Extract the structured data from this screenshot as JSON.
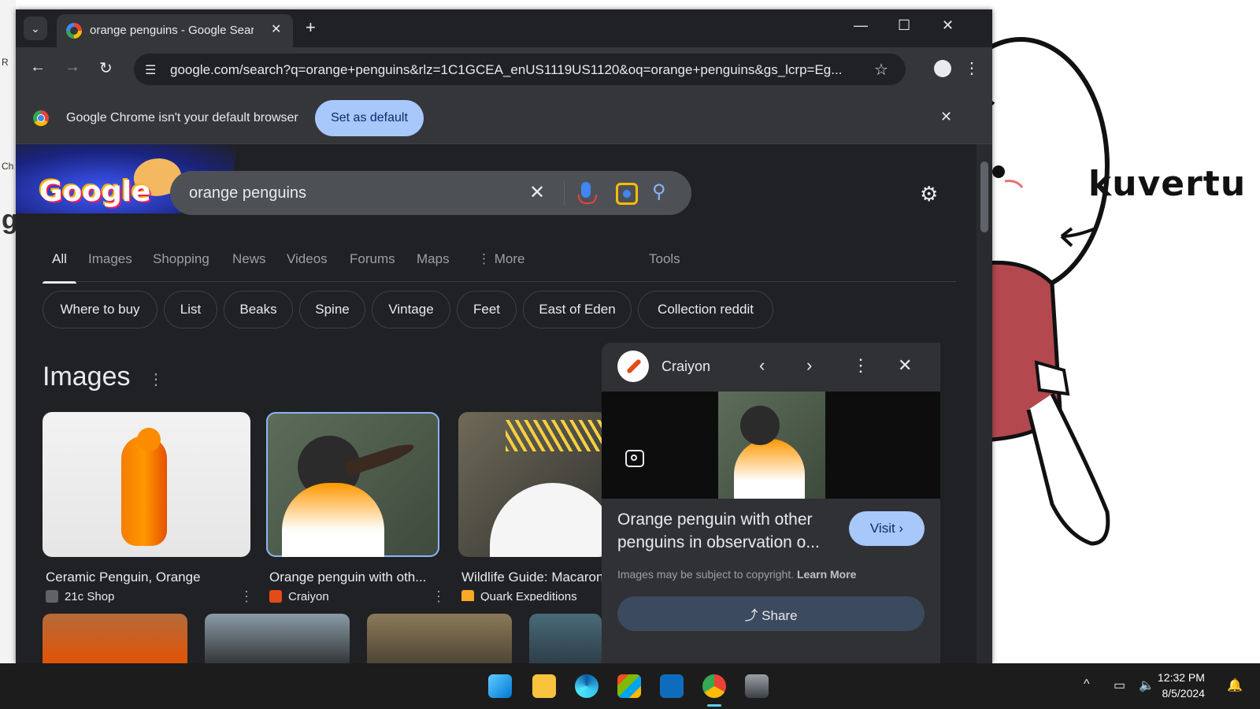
{
  "tab": {
    "title": "orange penguins - Google Search",
    "close": "✕",
    "new_tab": "+"
  },
  "window_controls": {
    "minimize": "—",
    "maximize": "☐",
    "close": "✕"
  },
  "toolbar": {
    "url": "google.com/search?q=orange+penguins&rlz=1C1GCEA_enUS1119US1120&oq=orange+penguins&gs_lcrp=Eg...",
    "back": "←",
    "forward": "→",
    "reload": "↻",
    "star": "☆",
    "menu": "⋮"
  },
  "infobar": {
    "message": "Google Chrome isn't your default browser",
    "button": "Set as default",
    "close": "✕"
  },
  "search": {
    "query": "orange penguins",
    "clear": "✕",
    "submit": "⚲"
  },
  "logo": {
    "text": "Google"
  },
  "settings_icon": "⚙",
  "nav_tabs": [
    {
      "label": "All",
      "active": true
    },
    {
      "label": "Images"
    },
    {
      "label": "Shopping"
    },
    {
      "label": "News"
    },
    {
      "label": "Videos"
    },
    {
      "label": "Forums"
    },
    {
      "label": "Maps"
    },
    {
      "label": "⋮ More"
    },
    {
      "label": "Tools"
    }
  ],
  "chips": [
    "Where to buy",
    "List",
    "Beaks",
    "Spine",
    "Vintage",
    "Feet",
    "East of Eden",
    "Collection reddit"
  ],
  "images_section": {
    "heading": "Images",
    "menu": "⋮"
  },
  "image_results": [
    {
      "caption": "Ceramic Penguin, Orange",
      "source": "21c Shop",
      "more": "⋮"
    },
    {
      "caption": "Orange penguin with oth...",
      "source": "Craiyon",
      "more": "⋮"
    },
    {
      "caption": "Wildlife Guide: Macaroni",
      "source": "Quark Expeditions"
    }
  ],
  "panel": {
    "source": "Craiyon",
    "prev": "‹",
    "next": "›",
    "menu": "⋮",
    "close": "✕",
    "title": "Orange penguin with other penguins in observation o...",
    "visit": "Visit ›",
    "copyright": "Images may be subject to copyright.",
    "learn_more": "Learn More",
    "share": "⤴ Share"
  },
  "desktop": {
    "wallpaper_text": "kuvertu",
    "left_edge": [
      "R",
      "Ch",
      "g"
    ]
  },
  "taskbar": {
    "time": "12:32 PM",
    "date": "8/5/2024",
    "tray_up": "^"
  },
  "colors": {
    "accent": "#a8c7fa",
    "page_bg": "#202124",
    "panel_bg": "#303134"
  }
}
